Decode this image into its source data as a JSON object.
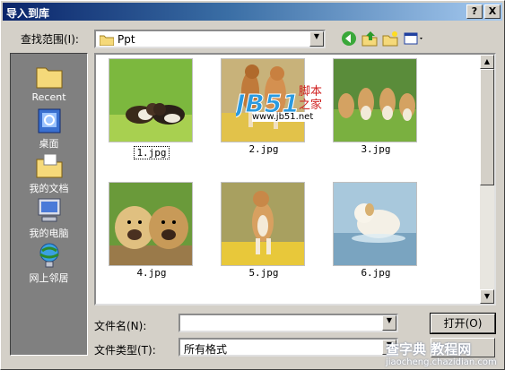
{
  "window": {
    "title": "导入到库"
  },
  "titlebar_buttons": {
    "help": "?",
    "close": "X"
  },
  "lookin": {
    "label": "查找范围(I):",
    "value": "Ppt"
  },
  "places": [
    {
      "label": "Recent",
      "icon": "recent-folder-icon"
    },
    {
      "label": "桌面",
      "icon": "desktop-icon"
    },
    {
      "label": "我的文档",
      "icon": "my-documents-icon"
    },
    {
      "label": "我的电脑",
      "icon": "my-computer-icon"
    },
    {
      "label": "网上邻居",
      "icon": "network-icon"
    }
  ],
  "files": [
    {
      "name": "1.jpg",
      "selected": true
    },
    {
      "name": "2.jpg",
      "selected": false
    },
    {
      "name": "3.jpg",
      "selected": false
    },
    {
      "name": "4.jpg",
      "selected": false
    },
    {
      "name": "5.jpg",
      "selected": false
    },
    {
      "name": "6.jpg",
      "selected": false
    }
  ],
  "filename": {
    "label": "文件名(N):",
    "value": ""
  },
  "filetype": {
    "label": "文件类型(T):",
    "value": "所有格式"
  },
  "buttons": {
    "open": "打开(O)"
  },
  "watermarks": {
    "jb51_logo": "JB51",
    "jb51_side": "脚本之家",
    "jb51_url": "www.jb51.net",
    "chazidian_logo": "查字典 教程网",
    "chazidian_url": "jiaocheng.chazidian.com"
  },
  "colors": {
    "title_start": "#0a246a",
    "title_end": "#a6caf0",
    "face": "#d4d0c8",
    "places_bg": "#808080"
  }
}
